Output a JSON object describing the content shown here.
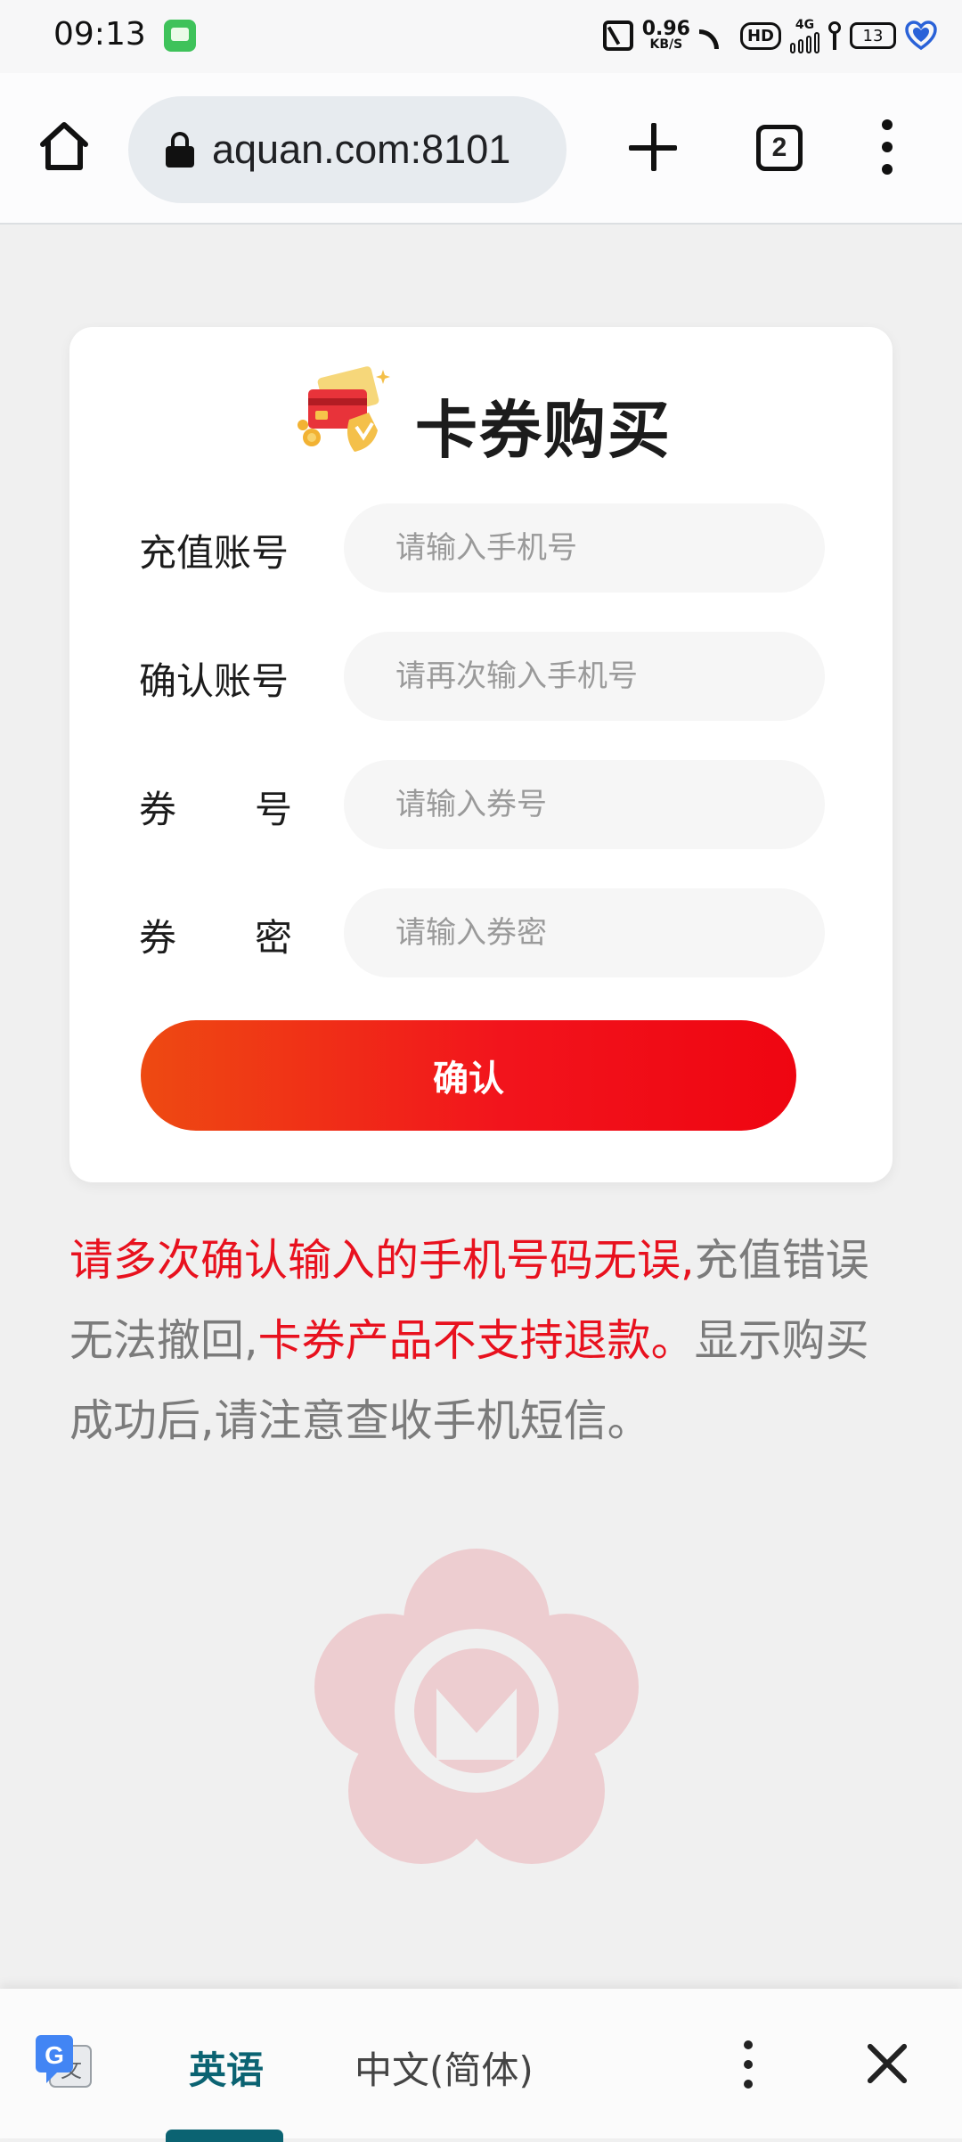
{
  "status_bar": {
    "time": "09:13",
    "net_speed_value": "0.96",
    "net_speed_unit": "KB/S",
    "hd_label": "HD",
    "network_type": "4G",
    "battery_level": "13"
  },
  "browser": {
    "url": "aquan.com:8101",
    "tab_count": "2"
  },
  "card": {
    "title": "卡券购买",
    "fields": [
      {
        "label_parts": [
          "充值账号"
        ],
        "placeholder": "请输入手机号"
      },
      {
        "label_parts": [
          "确认账号"
        ],
        "placeholder": "请再次输入手机号"
      },
      {
        "label_parts": [
          "券",
          "号"
        ],
        "placeholder": "请输入券号"
      },
      {
        "label_parts": [
          "券",
          "密"
        ],
        "placeholder": "请输入券密"
      }
    ],
    "confirm_label": "确认"
  },
  "notice": {
    "red_1": "请多次确认输入的手机号码无误,",
    "gray_1": "充值错误无法撤回,",
    "red_2": "卡券产品不支持退款。",
    "gray_2": "显示购买成功后,请注意查收手机短信。"
  },
  "translate_bar": {
    "active_language": "英语",
    "inactive_language": "中文(简体)",
    "translate_icon_letters": [
      "G",
      "文"
    ]
  },
  "colors": {
    "accent_red": "#e8111e",
    "button_gradient_start": "#ee4a12",
    "button_gradient_end": "#ef0511",
    "translate_accent": "#0b6372"
  }
}
